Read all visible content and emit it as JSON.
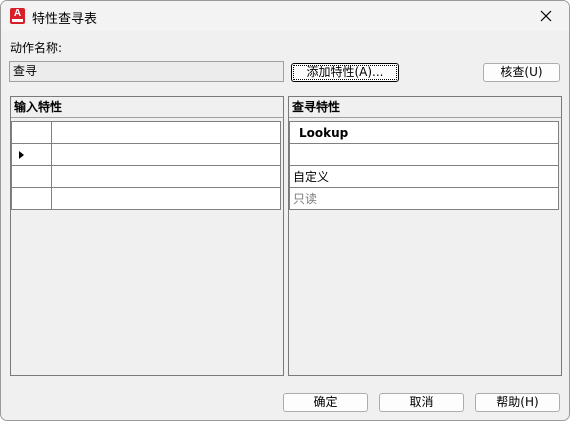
{
  "window": {
    "title": "特性查寻表",
    "icon": "autocad-icon",
    "icon_letter": "A",
    "accent_color": "#d81e28"
  },
  "action": {
    "label": "动作名称:",
    "value": "查寻"
  },
  "buttons": {
    "add": "添加特性(A)...",
    "verify": "核查(U)",
    "ok": "确定",
    "cancel": "取消",
    "help": "帮助(H)"
  },
  "input_panel": {
    "header": "输入特性",
    "rows": [
      {
        "value": "",
        "current": false
      },
      {
        "value": "",
        "current": true
      },
      {
        "value": "",
        "current": false
      },
      {
        "value": "",
        "current": false
      }
    ]
  },
  "lookup_panel": {
    "header": "查寻特性",
    "rows": [
      "Lookup",
      "",
      "自定义",
      "只读"
    ]
  }
}
